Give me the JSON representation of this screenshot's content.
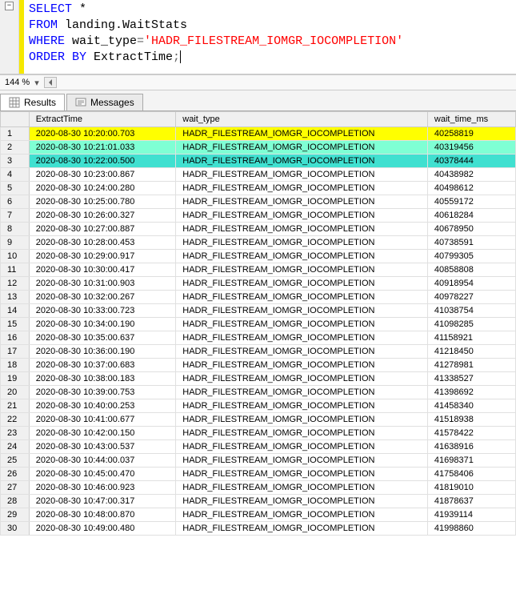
{
  "editor": {
    "line1_kw": "SELECT",
    "line1_rest": " *",
    "line2_kw": "FROM",
    "line2_rest": " landing.WaitStats",
    "line3_kw": "WHERE",
    "line3_rest": " wait_type",
    "line3_eq": "=",
    "line3_str": "'HADR_FILESTREAM_IOMGR_IOCOMPLETION'",
    "line4_kw": "ORDER BY",
    "line4_rest": " ExtractTime",
    "line4_semi": ";",
    "fold_symbol": "−"
  },
  "zoom": {
    "label": "144 %",
    "dash": "▾"
  },
  "tabs": {
    "results": "Results",
    "messages": "Messages"
  },
  "grid": {
    "headers": {
      "extract": "ExtractTime",
      "wait": "wait_type",
      "ms": "wait_time_ms"
    },
    "rows": [
      {
        "n": "1",
        "t": "2020-08-30 10:20:00.703",
        "w": "HADR_FILESTREAM_IOMGR_IOCOMPLETION",
        "m": "40258819",
        "hl": "yellow"
      },
      {
        "n": "2",
        "t": "2020-08-30 10:21:01.033",
        "w": "HADR_FILESTREAM_IOMGR_IOCOMPLETION",
        "m": "40319456",
        "hl": "green-light"
      },
      {
        "n": "3",
        "t": "2020-08-30 10:22:00.500",
        "w": "HADR_FILESTREAM_IOMGR_IOCOMPLETION",
        "m": "40378444",
        "hl": "green"
      },
      {
        "n": "4",
        "t": "2020-08-30 10:23:00.867",
        "w": "HADR_FILESTREAM_IOMGR_IOCOMPLETION",
        "m": "40438982"
      },
      {
        "n": "5",
        "t": "2020-08-30 10:24:00.280",
        "w": "HADR_FILESTREAM_IOMGR_IOCOMPLETION",
        "m": "40498612"
      },
      {
        "n": "6",
        "t": "2020-08-30 10:25:00.780",
        "w": "HADR_FILESTREAM_IOMGR_IOCOMPLETION",
        "m": "40559172"
      },
      {
        "n": "7",
        "t": "2020-08-30 10:26:00.327",
        "w": "HADR_FILESTREAM_IOMGR_IOCOMPLETION",
        "m": "40618284"
      },
      {
        "n": "8",
        "t": "2020-08-30 10:27:00.887",
        "w": "HADR_FILESTREAM_IOMGR_IOCOMPLETION",
        "m": "40678950"
      },
      {
        "n": "9",
        "t": "2020-08-30 10:28:00.453",
        "w": "HADR_FILESTREAM_IOMGR_IOCOMPLETION",
        "m": "40738591"
      },
      {
        "n": "10",
        "t": "2020-08-30 10:29:00.917",
        "w": "HADR_FILESTREAM_IOMGR_IOCOMPLETION",
        "m": "40799305"
      },
      {
        "n": "11",
        "t": "2020-08-30 10:30:00.417",
        "w": "HADR_FILESTREAM_IOMGR_IOCOMPLETION",
        "m": "40858808"
      },
      {
        "n": "12",
        "t": "2020-08-30 10:31:00.903",
        "w": "HADR_FILESTREAM_IOMGR_IOCOMPLETION",
        "m": "40918954"
      },
      {
        "n": "13",
        "t": "2020-08-30 10:32:00.267",
        "w": "HADR_FILESTREAM_IOMGR_IOCOMPLETION",
        "m": "40978227"
      },
      {
        "n": "14",
        "t": "2020-08-30 10:33:00.723",
        "w": "HADR_FILESTREAM_IOMGR_IOCOMPLETION",
        "m": "41038754"
      },
      {
        "n": "15",
        "t": "2020-08-30 10:34:00.190",
        "w": "HADR_FILESTREAM_IOMGR_IOCOMPLETION",
        "m": "41098285"
      },
      {
        "n": "16",
        "t": "2020-08-30 10:35:00.637",
        "w": "HADR_FILESTREAM_IOMGR_IOCOMPLETION",
        "m": "41158921"
      },
      {
        "n": "17",
        "t": "2020-08-30 10:36:00.190",
        "w": "HADR_FILESTREAM_IOMGR_IOCOMPLETION",
        "m": "41218450"
      },
      {
        "n": "18",
        "t": "2020-08-30 10:37:00.683",
        "w": "HADR_FILESTREAM_IOMGR_IOCOMPLETION",
        "m": "41278981"
      },
      {
        "n": "19",
        "t": "2020-08-30 10:38:00.183",
        "w": "HADR_FILESTREAM_IOMGR_IOCOMPLETION",
        "m": "41338527"
      },
      {
        "n": "20",
        "t": "2020-08-30 10:39:00.753",
        "w": "HADR_FILESTREAM_IOMGR_IOCOMPLETION",
        "m": "41398692"
      },
      {
        "n": "21",
        "t": "2020-08-30 10:40:00.253",
        "w": "HADR_FILESTREAM_IOMGR_IOCOMPLETION",
        "m": "41458340"
      },
      {
        "n": "22",
        "t": "2020-08-30 10:41:00.677",
        "w": "HADR_FILESTREAM_IOMGR_IOCOMPLETION",
        "m": "41518938"
      },
      {
        "n": "23",
        "t": "2020-08-30 10:42:00.150",
        "w": "HADR_FILESTREAM_IOMGR_IOCOMPLETION",
        "m": "41578422"
      },
      {
        "n": "24",
        "t": "2020-08-30 10:43:00.537",
        "w": "HADR_FILESTREAM_IOMGR_IOCOMPLETION",
        "m": "41638916"
      },
      {
        "n": "25",
        "t": "2020-08-30 10:44:00.037",
        "w": "HADR_FILESTREAM_IOMGR_IOCOMPLETION",
        "m": "41698371"
      },
      {
        "n": "26",
        "t": "2020-08-30 10:45:00.470",
        "w": "HADR_FILESTREAM_IOMGR_IOCOMPLETION",
        "m": "41758406"
      },
      {
        "n": "27",
        "t": "2020-08-30 10:46:00.923",
        "w": "HADR_FILESTREAM_IOMGR_IOCOMPLETION",
        "m": "41819010"
      },
      {
        "n": "28",
        "t": "2020-08-30 10:47:00.317",
        "w": "HADR_FILESTREAM_IOMGR_IOCOMPLETION",
        "m": "41878637"
      },
      {
        "n": "29",
        "t": "2020-08-30 10:48:00.870",
        "w": "HADR_FILESTREAM_IOMGR_IOCOMPLETION",
        "m": "41939114"
      },
      {
        "n": "30",
        "t": "2020-08-30 10:49:00.480",
        "w": "HADR_FILESTREAM_IOMGR_IOCOMPLETION",
        "m": "41998860"
      }
    ]
  }
}
